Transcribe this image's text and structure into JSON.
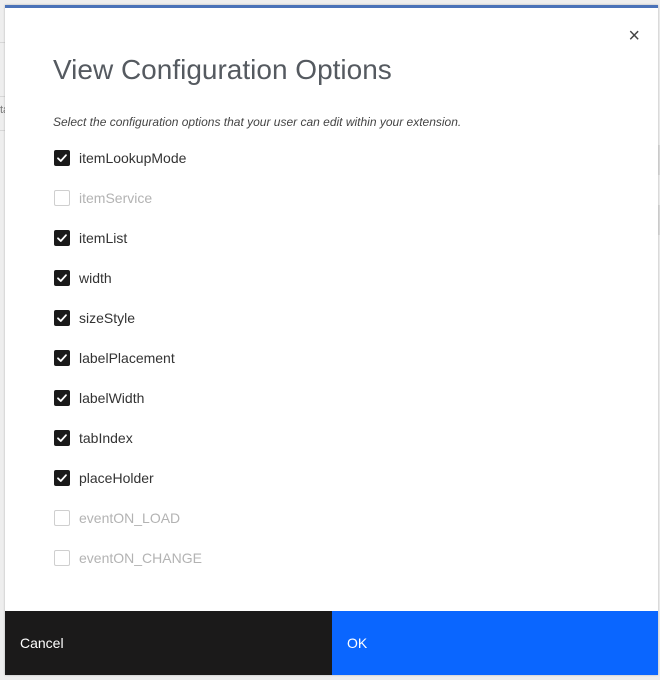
{
  "dialog": {
    "title": "View Configuration Options",
    "subtitle": "Select the configuration options that your user can edit within your extension.",
    "close_label": "×",
    "options": [
      {
        "label": "itemLookupMode",
        "checked": true,
        "enabled": true
      },
      {
        "label": "itemService",
        "checked": false,
        "enabled": false
      },
      {
        "label": "itemList",
        "checked": true,
        "enabled": true
      },
      {
        "label": "width",
        "checked": true,
        "enabled": true
      },
      {
        "label": "sizeStyle",
        "checked": true,
        "enabled": true
      },
      {
        "label": "labelPlacement",
        "checked": true,
        "enabled": true
      },
      {
        "label": "labelWidth",
        "checked": true,
        "enabled": true
      },
      {
        "label": "tabIndex",
        "checked": true,
        "enabled": true
      },
      {
        "label": "placeHolder",
        "checked": true,
        "enabled": true
      },
      {
        "label": "eventON_LOAD",
        "checked": false,
        "enabled": false
      },
      {
        "label": "eventON_CHANGE",
        "checked": false,
        "enabled": false
      }
    ],
    "cancel_label": "Cancel",
    "ok_label": "OK"
  },
  "background": {
    "fragment_text": "ta"
  },
  "colors": {
    "header_accent": "#4a72b8",
    "cancel_bg": "#1b1a1a",
    "ok_bg": "#0a66ff",
    "checkbox_checked": "#1a1a1a",
    "disabled_text": "#b3b3b3"
  }
}
